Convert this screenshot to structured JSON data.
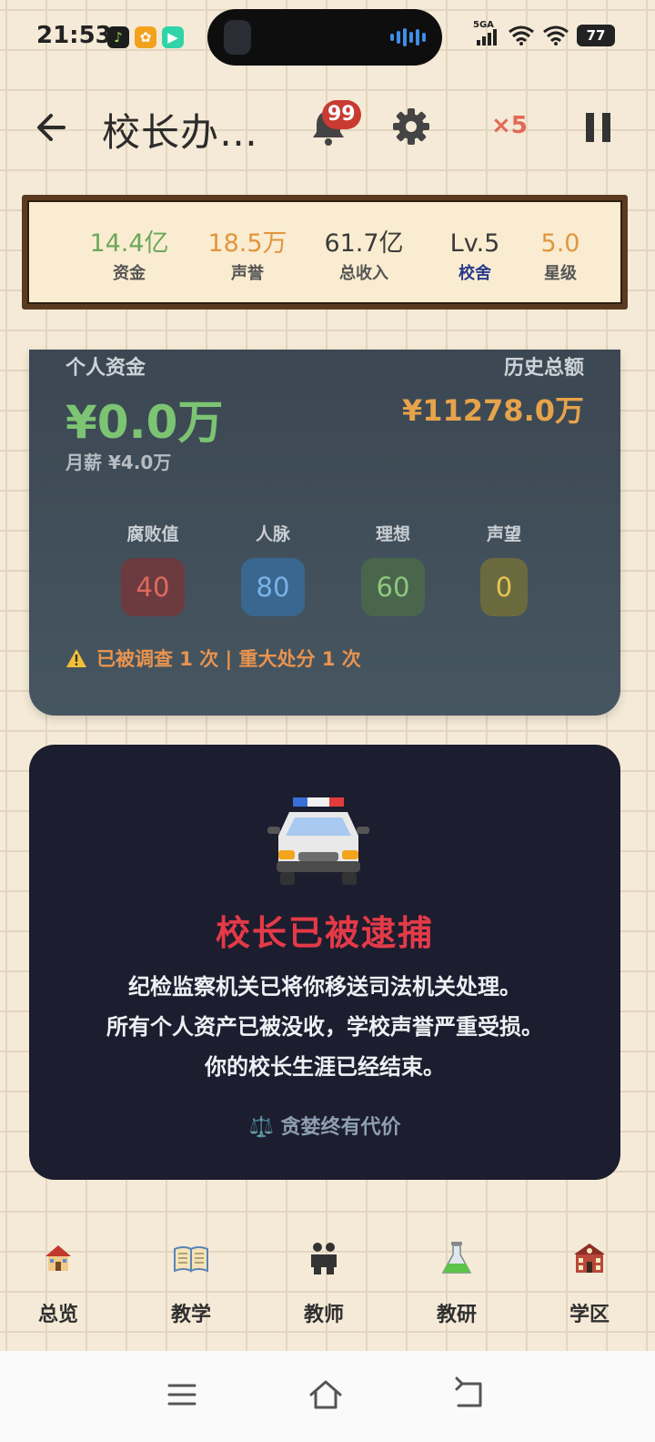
{
  "status_bar": {
    "time": "21:53",
    "network": "5GA",
    "battery": "77",
    "app_icons": [
      "music-app-icon",
      "orange-app-icon",
      "video-app-icon"
    ]
  },
  "header": {
    "title": "校长办…",
    "notification_count": "99",
    "speed": "×5"
  },
  "stats": [
    {
      "value": "14.4亿",
      "label": "资金",
      "value_color": "#6aa85a",
      "label_color": "#555555"
    },
    {
      "value": "18.5万",
      "label": "声誉",
      "value_color": "#e0963f",
      "label_color": "#555555"
    },
    {
      "value": "61.7亿",
      "label": "总收入",
      "value_color": "#3a3a3a",
      "label_color": "#555555"
    },
    {
      "value": "Lv.5",
      "label": "校舍",
      "value_color": "#3a3a3a",
      "label_color": "#2a3a8c"
    },
    {
      "value": "5.0",
      "label": "星级",
      "value_color": "#e0963f",
      "label_color": "#555555"
    }
  ],
  "personal": {
    "funds_label": "个人资金",
    "funds_value": "¥0.0万",
    "history_label": "历史总额",
    "history_value": "¥11278.0万",
    "salary": "月薪 ¥4.0万",
    "metrics": [
      {
        "label": "腐败值",
        "value": "40",
        "bg": "#6b3b40",
        "fg": "#e06a5e"
      },
      {
        "label": "人脉",
        "value": "80",
        "bg": "#3a6790",
        "fg": "#7ab2e6"
      },
      {
        "label": "理想",
        "value": "60",
        "bg": "#49664c",
        "fg": "#8ec77f"
      },
      {
        "label": "声望",
        "value": "0",
        "bg": "#6b6a3f",
        "fg": "#e7c653"
      }
    ],
    "warning": "已被调查 1 次 | 重大处分 1 次"
  },
  "arrest": {
    "title": "校长已被逮捕",
    "lines": [
      "纪检监察机关已将你移送司法机关处理。",
      "所有个人资产已被没收，学校声誉严重受损。",
      "你的校长生涯已经结束。"
    ],
    "footer": "⚖️ 贪婪终有代价"
  },
  "nav": [
    {
      "label": "总览",
      "icon": "school-icon"
    },
    {
      "label": "教学",
      "icon": "book-icon"
    },
    {
      "label": "教师",
      "icon": "teachers-icon"
    },
    {
      "label": "教研",
      "icon": "flask-icon"
    },
    {
      "label": "学区",
      "icon": "district-icon"
    }
  ]
}
